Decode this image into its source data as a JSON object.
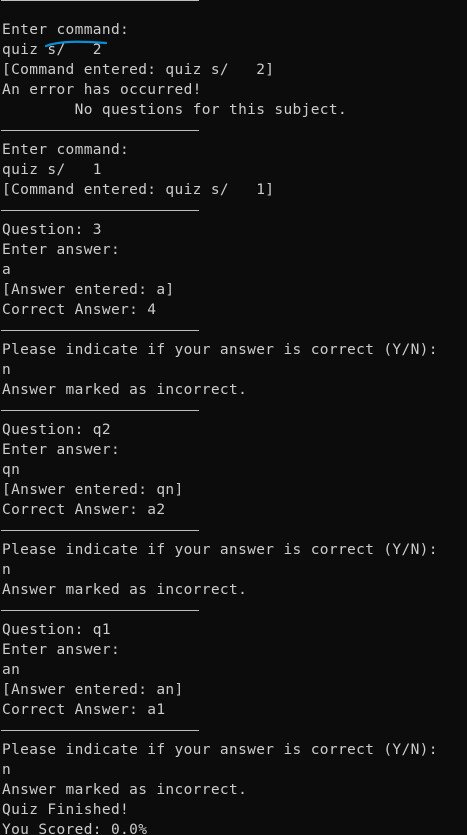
{
  "terminal": {
    "background": "#0c0c0c",
    "foreground": "#cccccc",
    "annotation_color": "#0a8fd6",
    "lines": [
      {
        "kind": "sep",
        "text": ""
      },
      {
        "kind": "text",
        "text": "Enter command:"
      },
      {
        "kind": "text",
        "text": "quiz s/   2"
      },
      {
        "kind": "text",
        "text": "[Command entered: quiz s/   2]"
      },
      {
        "kind": "text",
        "text": "An error has occurred!"
      },
      {
        "kind": "text",
        "text": "        No questions for this subject."
      },
      {
        "kind": "sep",
        "text": ""
      },
      {
        "kind": "text",
        "text": "Enter command:"
      },
      {
        "kind": "text",
        "text": "quiz s/   1"
      },
      {
        "kind": "text",
        "text": "[Command entered: quiz s/   1]"
      },
      {
        "kind": "sep",
        "text": ""
      },
      {
        "kind": "text",
        "text": "Question: 3"
      },
      {
        "kind": "text",
        "text": "Enter answer:"
      },
      {
        "kind": "text",
        "text": "a"
      },
      {
        "kind": "text",
        "text": "[Answer entered: a]"
      },
      {
        "kind": "text",
        "text": "Correct Answer: 4"
      },
      {
        "kind": "sep",
        "text": ""
      },
      {
        "kind": "text",
        "text": "Please indicate if your answer is correct (Y/N):"
      },
      {
        "kind": "text",
        "text": "n"
      },
      {
        "kind": "text",
        "text": "Answer marked as incorrect."
      },
      {
        "kind": "sep",
        "text": ""
      },
      {
        "kind": "text",
        "text": "Question: q2"
      },
      {
        "kind": "text",
        "text": "Enter answer:"
      },
      {
        "kind": "text",
        "text": "qn"
      },
      {
        "kind": "text",
        "text": "[Answer entered: qn]"
      },
      {
        "kind": "text",
        "text": "Correct Answer: a2"
      },
      {
        "kind": "sep",
        "text": ""
      },
      {
        "kind": "text",
        "text": "Please indicate if your answer is correct (Y/N):"
      },
      {
        "kind": "text",
        "text": "n"
      },
      {
        "kind": "text",
        "text": "Answer marked as incorrect."
      },
      {
        "kind": "sep",
        "text": ""
      },
      {
        "kind": "text",
        "text": "Question: q1"
      },
      {
        "kind": "text",
        "text": "Enter answer:"
      },
      {
        "kind": "text",
        "text": "an"
      },
      {
        "kind": "text",
        "text": "[Answer entered: an]"
      },
      {
        "kind": "text",
        "text": "Correct Answer: a1"
      },
      {
        "kind": "sep",
        "text": ""
      },
      {
        "kind": "text",
        "text": "Please indicate if your answer is correct (Y/N):"
      },
      {
        "kind": "text",
        "text": "n"
      },
      {
        "kind": "text",
        "text": "Answer marked as incorrect."
      },
      {
        "kind": "text",
        "text": "Quiz Finished!"
      },
      {
        "kind": "text",
        "text": "You Scored: 0.0%"
      }
    ]
  }
}
